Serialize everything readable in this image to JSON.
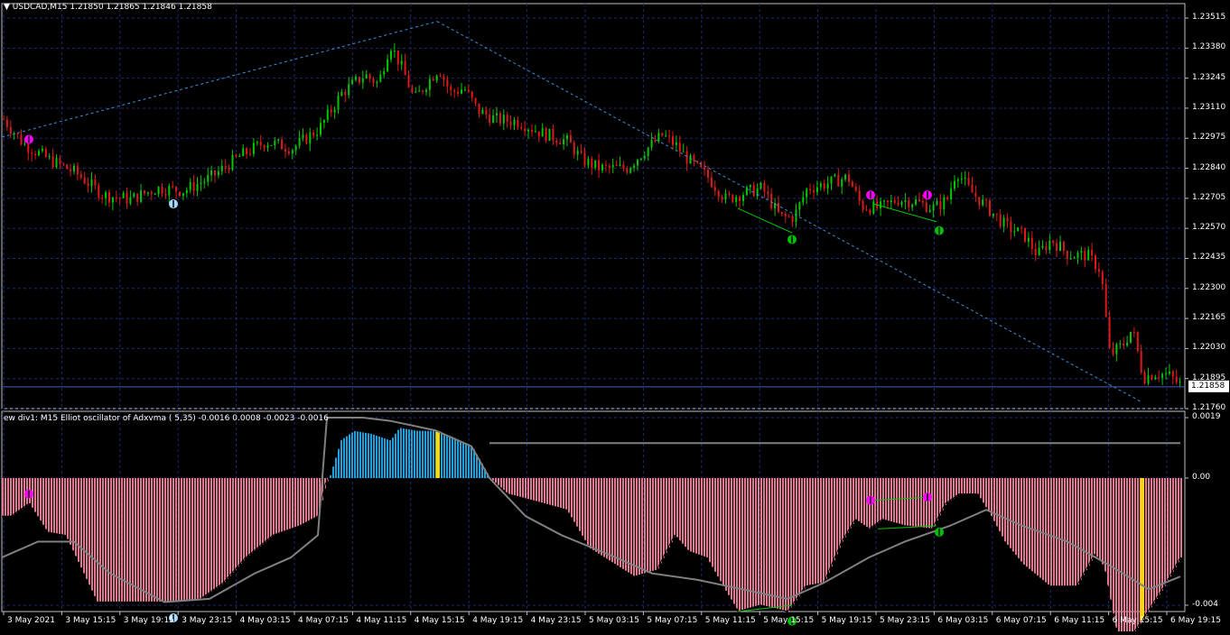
{
  "main_header": {
    "symbol": "USDCAD,M15",
    "ohlc": "1.21850 1.21865 1.21846 1.21858"
  },
  "osc_header": {
    "text": "ew div1: M15 Elliot oscillator of Adxvma ( 5,35) -0.0016 0.0008 -0.0023 -0.0016"
  },
  "price_axis": {
    "ticks": [
      "1.23515",
      "1.23380",
      "1.23245",
      "1.23110",
      "1.22975",
      "1.22840",
      "1.22705",
      "1.22570",
      "1.22435",
      "1.22300",
      "1.22165",
      "1.22030",
      "1.21895",
      "1.21760"
    ],
    "current": "1.21858"
  },
  "osc_axis": {
    "ticks": [
      "0.0019",
      "0.00",
      "-0.004"
    ]
  },
  "time_axis": {
    "labels": [
      "3 May 2021",
      "3 May 15:15",
      "3 May 19:15",
      "3 May 23:15",
      "4 May 03:15",
      "4 May 07:15",
      "4 May 11:15",
      "4 May 15:15",
      "4 May 19:15",
      "4 May 23:15",
      "5 May 03:15",
      "5 May 07:15",
      "5 May 11:15",
      "5 May 15:15",
      "5 May 19:15",
      "5 May 23:15",
      "6 May 03:15",
      "6 May 07:15",
      "6 May 11:15",
      "6 May 15:15",
      "6 May 19:15"
    ]
  },
  "colors": {
    "background": "#000000",
    "grid": "#1c2a6e",
    "bull": "#00c800",
    "bear": "#e01818",
    "trendline": "#3a8fd8",
    "osc_positive": "#1ea0dc",
    "osc_negative": "#e07890",
    "signal_line": "#808080",
    "highlight_bar": "#ffd700",
    "arrow_up_blue": "#a8d8ff",
    "arrow_up_green": "#00c000",
    "arrow_down_magenta": "#ff00ff",
    "divergence_line": "#00c800",
    "axis_text": "#ffffff"
  },
  "chart_data": [
    {
      "type": "candlestick",
      "symbol": "USDCAD",
      "timeframe": "M15",
      "ylim": [
        1.2176,
        1.2358
      ],
      "close_path_points": [
        [
          0,
          1.2306
        ],
        [
          22,
          1.2295
        ],
        [
          50,
          1.2288
        ],
        [
          80,
          1.2282
        ],
        [
          110,
          1.2272
        ],
        [
          140,
          1.227
        ],
        [
          170,
          1.2275
        ],
        [
          200,
          1.2274
        ],
        [
          230,
          1.228
        ],
        [
          260,
          1.2289
        ],
        [
          290,
          1.2296
        ],
        [
          320,
          1.2293
        ],
        [
          350,
          1.2302
        ],
        [
          375,
          1.2318
        ],
        [
          400,
          1.2326
        ],
        [
          415,
          1.2322
        ],
        [
          428,
          1.234
        ],
        [
          440,
          1.233
        ],
        [
          455,
          1.2315
        ],
        [
          470,
          1.2323
        ],
        [
          482,
          1.2329
        ],
        [
          495,
          1.2318
        ],
        [
          510,
          1.232
        ],
        [
          525,
          1.231
        ],
        [
          545,
          1.2306
        ],
        [
          570,
          1.2305
        ],
        [
          595,
          1.23
        ],
        [
          625,
          1.2296
        ],
        [
          640,
          1.2288
        ],
        [
          660,
          1.2284
        ],
        [
          690,
          1.2284
        ],
        [
          710,
          1.2292
        ],
        [
          730,
          1.2299
        ],
        [
          745,
          1.2294
        ],
        [
          760,
          1.2287
        ],
        [
          780,
          1.228
        ],
        [
          800,
          1.227
        ],
        [
          820,
          1.2273
        ],
        [
          840,
          1.2275
        ],
        [
          860,
          1.2262
        ],
        [
          875,
          1.2262
        ],
        [
          890,
          1.2275
        ],
        [
          910,
          1.2277
        ],
        [
          935,
          1.228
        ],
        [
          950,
          1.2267
        ],
        [
          970,
          1.2266
        ],
        [
          990,
          1.227
        ],
        [
          1010,
          1.2269
        ],
        [
          1030,
          1.2266
        ],
        [
          1045,
          1.227
        ],
        [
          1055,
          1.2283
        ],
        [
          1070,
          1.2274
        ],
        [
          1090,
          1.2266
        ],
        [
          1110,
          1.2258
        ],
        [
          1130,
          1.2254
        ],
        [
          1145,
          1.2245
        ],
        [
          1160,
          1.2252
        ],
        [
          1180,
          1.2245
        ],
        [
          1200,
          1.2245
        ],
        [
          1215,
          1.2238
        ],
        [
          1225,
          1.22
        ],
        [
          1240,
          1.2205
        ],
        [
          1250,
          1.2212
        ],
        [
          1262,
          1.219
        ],
        [
          1275,
          1.2192
        ],
        [
          1290,
          1.2191
        ],
        [
          1305,
          1.2186
        ]
      ],
      "trendlines": [
        {
          "from": [
            0,
            1.2298
          ],
          "to": [
            482,
            1.235
          ]
        },
        {
          "from": [
            482,
            1.235
          ],
          "to": [
            1262,
            1.2179
          ]
        }
      ],
      "current_price": 1.21858,
      "arrows": [
        {
          "x": 30,
          "price": 1.2297,
          "kind": "down",
          "color": "magenta"
        },
        {
          "x": 190,
          "price": 1.2268,
          "kind": "up",
          "color": "lightblue"
        },
        {
          "x": 875,
          "price": 1.2252,
          "kind": "up",
          "color": "green"
        },
        {
          "x": 962,
          "price": 1.2272,
          "kind": "down",
          "color": "magenta"
        },
        {
          "x": 1025,
          "price": 1.2272,
          "kind": "down",
          "color": "magenta"
        },
        {
          "x": 1038,
          "price": 1.2256,
          "kind": "up",
          "color": "green"
        }
      ],
      "divergence_lines": [
        {
          "from": [
            815,
            1.2266
          ],
          "to": [
            875,
            1.2255
          ]
        },
        {
          "from": [
            965,
            1.2268
          ],
          "to": [
            1035,
            1.226
          ]
        }
      ]
    },
    {
      "type": "histogram",
      "name": "Elliot oscillator of Adxvma (5,35)",
      "ylim": [
        -0.0042,
        0.0021
      ],
      "zero": 0,
      "histogram_points": [
        [
          0,
          -0.0012
        ],
        [
          10,
          -0.0012
        ],
        [
          30,
          -0.0008
        ],
        [
          50,
          -0.0017
        ],
        [
          70,
          -0.0018
        ],
        [
          90,
          -0.003
        ],
        [
          105,
          -0.0039
        ],
        [
          130,
          -0.0039
        ],
        [
          160,
          -0.0039
        ],
        [
          190,
          -0.0039
        ],
        [
          220,
          -0.0038
        ],
        [
          245,
          -0.0033
        ],
        [
          270,
          -0.0025
        ],
        [
          300,
          -0.0018
        ],
        [
          330,
          -0.0015
        ],
        [
          350,
          -0.0012
        ],
        [
          358,
          -0.0002
        ],
        [
          362,
          0.0
        ],
        [
          375,
          0.0012
        ],
        [
          390,
          0.0015
        ],
        [
          410,
          0.0014
        ],
        [
          430,
          0.0012
        ],
        [
          440,
          0.0016
        ],
        [
          460,
          0.0015
        ],
        [
          482,
          0.0015
        ],
        [
          500,
          0.0013
        ],
        [
          520,
          0.001
        ],
        [
          540,
          0.0
        ],
        [
          560,
          -0.0005
        ],
        [
          600,
          -0.0008
        ],
        [
          625,
          -0.001
        ],
        [
          650,
          -0.0022
        ],
        [
          700,
          -0.0031
        ],
        [
          725,
          -0.0029
        ],
        [
          745,
          -0.0018
        ],
        [
          760,
          -0.0023
        ],
        [
          780,
          -0.0025
        ],
        [
          800,
          -0.0035
        ],
        [
          815,
          -0.0042
        ],
        [
          840,
          -0.004
        ],
        [
          870,
          -0.0042
        ],
        [
          890,
          -0.0034
        ],
        [
          910,
          -0.0033
        ],
        [
          930,
          -0.002
        ],
        [
          945,
          -0.0013
        ],
        [
          960,
          -0.0016
        ],
        [
          975,
          -0.0013
        ],
        [
          1000,
          -0.0015
        ],
        [
          1030,
          -0.0016
        ],
        [
          1045,
          -0.0008
        ],
        [
          1060,
          -0.0005
        ],
        [
          1080,
          -0.0005
        ],
        [
          1095,
          -0.0012
        ],
        [
          1110,
          -0.002
        ],
        [
          1130,
          -0.0027
        ],
        [
          1160,
          -0.0034
        ],
        [
          1190,
          -0.0034
        ],
        [
          1210,
          -0.0024
        ],
        [
          1220,
          -0.0028
        ],
        [
          1235,
          -0.005
        ],
        [
          1245,
          -0.0052
        ],
        [
          1262,
          -0.0045
        ],
        [
          1285,
          -0.0035
        ],
        [
          1305,
          -0.0025
        ]
      ],
      "signal_points": [
        [
          0,
          -0.0025
        ],
        [
          40,
          -0.002
        ],
        [
          80,
          -0.002
        ],
        [
          120,
          -0.003
        ],
        [
          180,
          -0.0039
        ],
        [
          230,
          -0.0038
        ],
        [
          280,
          -0.003
        ],
        [
          320,
          -0.0025
        ],
        [
          350,
          -0.0018
        ],
        [
          360,
          0.0019
        ],
        [
          400,
          0.0019
        ],
        [
          430,
          0.0018
        ],
        [
          480,
          0.0015
        ],
        [
          520,
          0.001
        ],
        [
          540,
          0.0
        ],
        [
          580,
          -0.0012
        ],
        [
          620,
          -0.0018
        ],
        [
          680,
          -0.0025
        ],
        [
          720,
          -0.003
        ],
        [
          770,
          -0.0032
        ],
        [
          820,
          -0.0035
        ],
        [
          870,
          -0.0038
        ],
        [
          910,
          -0.0033
        ],
        [
          960,
          -0.0025
        ],
        [
          1000,
          -0.002
        ],
        [
          1050,
          -0.0015
        ],
        [
          1090,
          -0.001
        ],
        [
          1130,
          -0.0015
        ],
        [
          1180,
          -0.002
        ],
        [
          1230,
          -0.0028
        ],
        [
          1270,
          -0.0035
        ],
        [
          1305,
          -0.0031
        ]
      ],
      "upper_level_line": {
        "from": [
          540,
          0.0011
        ],
        "to": [
          1305,
          0.0011
        ]
      },
      "highlight_bars_x": [
        482,
        1262
      ],
      "arrows": [
        {
          "x": 30,
          "value": -0.0005,
          "kind": "down",
          "color": "magenta"
        },
        {
          "x": 190,
          "value": -0.0044,
          "kind": "up",
          "color": "lightblue"
        },
        {
          "x": 875,
          "value": -0.0045,
          "kind": "up",
          "color": "green"
        },
        {
          "x": 962,
          "value": -0.0007,
          "kind": "down",
          "color": "magenta"
        },
        {
          "x": 1025,
          "value": -0.0006,
          "kind": "down",
          "color": "magenta"
        },
        {
          "x": 1038,
          "value": -0.0017,
          "kind": "up",
          "color": "green"
        }
      ],
      "divergence_lines": [
        {
          "from": [
            815,
            -0.0042
          ],
          "to": [
            875,
            -0.004
          ]
        },
        {
          "from": [
            965,
            -0.0007
          ],
          "to": [
            1028,
            -0.0006
          ]
        },
        {
          "from": [
            970,
            -0.0016
          ],
          "to": [
            1035,
            -0.0015
          ]
        }
      ]
    }
  ]
}
